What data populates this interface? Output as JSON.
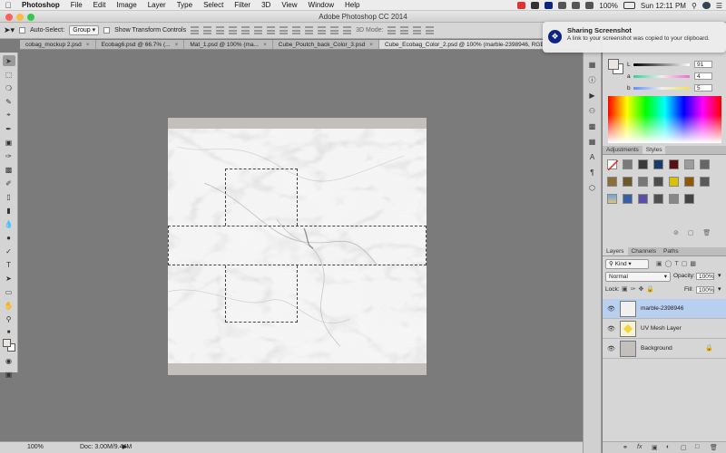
{
  "menubar": {
    "app": "Photoshop",
    "items": [
      "File",
      "Edit",
      "Image",
      "Layer",
      "Type",
      "Select",
      "Filter",
      "3D",
      "View",
      "Window",
      "Help"
    ],
    "battery": "100%",
    "clock": "Sun 12:11 PM"
  },
  "window": {
    "title": "Adobe Photoshop CC 2014"
  },
  "options": {
    "auto_select_label": "Auto-Select:",
    "auto_select_value": "Group",
    "show_transform_label": "Show Transform Controls",
    "mode_3d_label": "3D Mode:"
  },
  "tabs": [
    {
      "label": "cobag_mockup 2.psd",
      "active": false
    },
    {
      "label": "Ecobag6.psd @ 66.7% (...",
      "active": false
    },
    {
      "label": "Mat_1.psd @ 100% (ma...",
      "active": false
    },
    {
      "label": "Cube_Poutch_back_Color_3.psd",
      "active": false
    },
    {
      "label": "Cube_Ecobag_Color_2.psd @ 100% (marble-2398946, RGB",
      "active": true
    }
  ],
  "status": {
    "zoom": "100%",
    "doc": "Doc: 3.00M/9.44M"
  },
  "color_panel": {
    "L_label": "L",
    "L_value": "91",
    "a_label": "a",
    "a_value": "4",
    "b_label": "b",
    "b_value": "5"
  },
  "adjustments_tabs": [
    "Adjustments",
    "Styles"
  ],
  "layers_panel": {
    "tabs": [
      "Layers",
      "Channels",
      "Paths"
    ],
    "kind": "Kind",
    "blend_mode": "Normal",
    "opacity_label": "Opacity:",
    "opacity_value": "100%",
    "lock_label": "Lock:",
    "fill_label": "Fill:",
    "fill_value": "100%",
    "layers": [
      {
        "name": "marble-2398946",
        "selected": true
      },
      {
        "name": "UV Mesh Layer",
        "selected": false
      },
      {
        "name": "Background",
        "selected": false
      }
    ],
    "footer_icons": "fx"
  },
  "notification": {
    "title": "Sharing Screenshot",
    "body": "A link to your screenshot was copied to your clipboard."
  },
  "colors": {
    "accent": "#0d2481",
    "selected_layer": "#b8cff0"
  }
}
